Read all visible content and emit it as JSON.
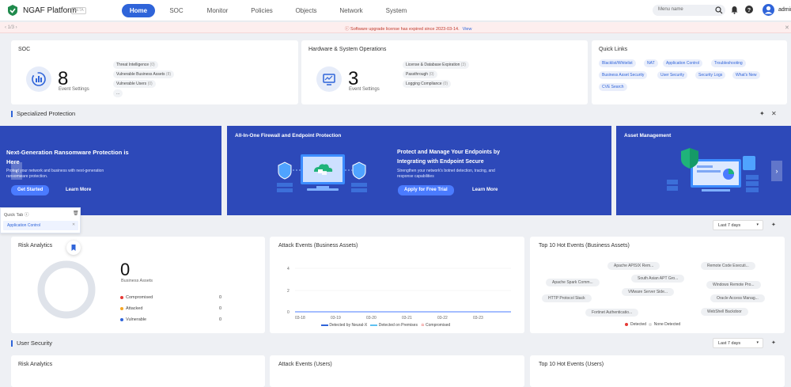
{
  "header": {
    "app_name": "NGAF Platform",
    "badge": "BETA",
    "nav": [
      "Home",
      "SOC",
      "Monitor",
      "Policies",
      "Objects",
      "Network",
      "System"
    ],
    "active_nav": "Home",
    "search_placeholder": "Menu name",
    "user": "admin"
  },
  "notice": {
    "pager": "‹ 1/3 ›",
    "message": "Software upgrade license has expired since 2023-03-14.",
    "link": "View"
  },
  "soc": {
    "title": "SOC",
    "count": "8",
    "sub": "Event Settings",
    "items": [
      {
        "label": "Threat Intelligence",
        "count": "(0)"
      },
      {
        "label": "Vulnerable Business Assets",
        "count": "(8)"
      },
      {
        "label": "Vulnerable Users",
        "count": "(0)"
      }
    ],
    "more": "..."
  },
  "hw": {
    "title": "Hardware & System Operations",
    "count": "3",
    "sub": "Event Settings",
    "items": [
      {
        "label": "License & Database Expiration",
        "count": "(3)"
      },
      {
        "label": "Passthrough",
        "count": "(0)"
      },
      {
        "label": "Logging Compliance",
        "count": "(0)"
      }
    ]
  },
  "quick_links": {
    "title": "Quick Links",
    "links": [
      "Blacklist/Whitelist",
      "NAT",
      "Application Control",
      "Troubleshooting",
      "Business Asset Security",
      "User Security",
      "Security Logs",
      "What's New",
      "CVE Search"
    ]
  },
  "specialized": {
    "title": "Specialized Protection",
    "banner1": {
      "title_line1": "Next-Generation Ransomware Protection is",
      "title_line2": "Here",
      "desc_line1": "Protect your network and business with next-generation",
      "desc_line2": "ransomware protection.",
      "cta": "Get Started",
      "link": "Learn More"
    },
    "banner2": {
      "heading": "All-In-One Firewall and Endpoint Protection",
      "title_line1": "Protect and Manage Your Endpoints by",
      "title_line2": "Integrating with Endpoint Secure",
      "desc_line1": "Strengthen your network's botnet detection, tracing, and",
      "desc_line2": "response capabilities",
      "cta": "Apply for Free Trial",
      "link": "Learn More"
    },
    "banner3": {
      "heading": "Asset Management"
    }
  },
  "quick_tab": {
    "title": "Quick Tab",
    "item": "Application Control"
  },
  "range": {
    "selected": "Last 7 days"
  },
  "risk": {
    "title": "Risk Analytics",
    "count": "0",
    "sub": "Business Assets",
    "legend": [
      {
        "label": "Compromised",
        "value": "0",
        "color": "#e53935"
      },
      {
        "label": "Attacked",
        "value": "0",
        "color": "#f5a623"
      },
      {
        "label": "Vulnerable",
        "value": "0",
        "color": "#2f64d9"
      }
    ]
  },
  "attack": {
    "title": "Attack Events (Business Assets)",
    "y_ticks": [
      "4",
      "2",
      "0"
    ],
    "x_ticks": [
      "03-18",
      "03-19",
      "03-20",
      "03-21",
      "03-22",
      "03-23"
    ],
    "legend": [
      "Detected by Neural-X",
      "Detected on Premises",
      "Compromised"
    ]
  },
  "hot": {
    "title": "Top 10 Hot Events (Business Assets)",
    "tags": [
      "Apache APISIX Rem...",
      "Remote Code Executi...",
      "South Asian APT Gro...",
      "Apache Spark Comm...",
      "Windows Remote Pro...",
      "VMware Server Side...",
      "HTTP Protocol Stack",
      "Oracle Access Manag...",
      "Fortinet Authenticatio...",
      "WebShell Backdoor"
    ],
    "legend": [
      "Detected",
      "None Detected"
    ]
  },
  "user_security": {
    "title": "User Security",
    "range": "Last 7 days",
    "cards": [
      "Risk Analytics",
      "Attack Events (Users)",
      "Top 10 Hot Events (Users)"
    ]
  }
}
